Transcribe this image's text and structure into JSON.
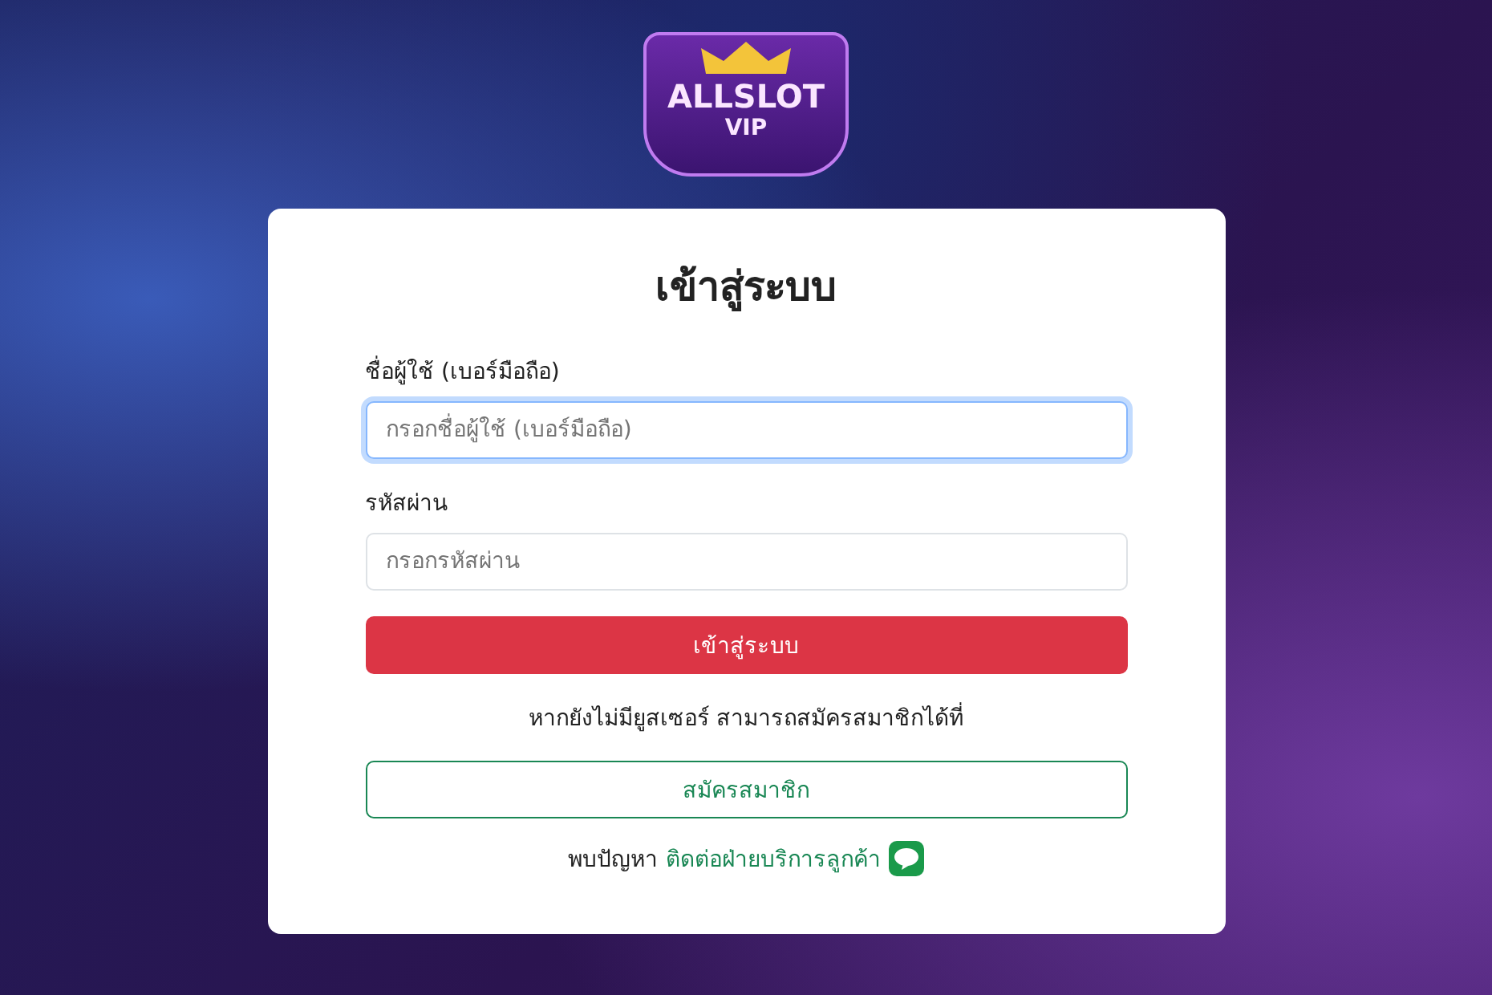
{
  "logo": {
    "title": "ALLSLOT",
    "subtitle": "VIP"
  },
  "login": {
    "title": "เข้าสู่ระบบ",
    "fields": [
      {
        "label": "ชื่อผู้ใช้ (เบอร์มือถือ)",
        "placeholder": "กรอกชื่อผู้ใช้ (เบอร์มือถือ)",
        "focused": true
      },
      {
        "label": "รหัสผ่าน",
        "placeholder": "กรอกรหัสผ่าน",
        "focused": false
      }
    ],
    "submit": "เข้าสู่ระบบ",
    "register_note": "หากยังไม่มียูสเซอร์ สามารถสมัครสมาชิกได้ที่",
    "register": "สมัครสมาชิก",
    "help_text": "พบปัญหา",
    "help_link": "ติดต่อฝ่ายบริการลูกค้า"
  }
}
